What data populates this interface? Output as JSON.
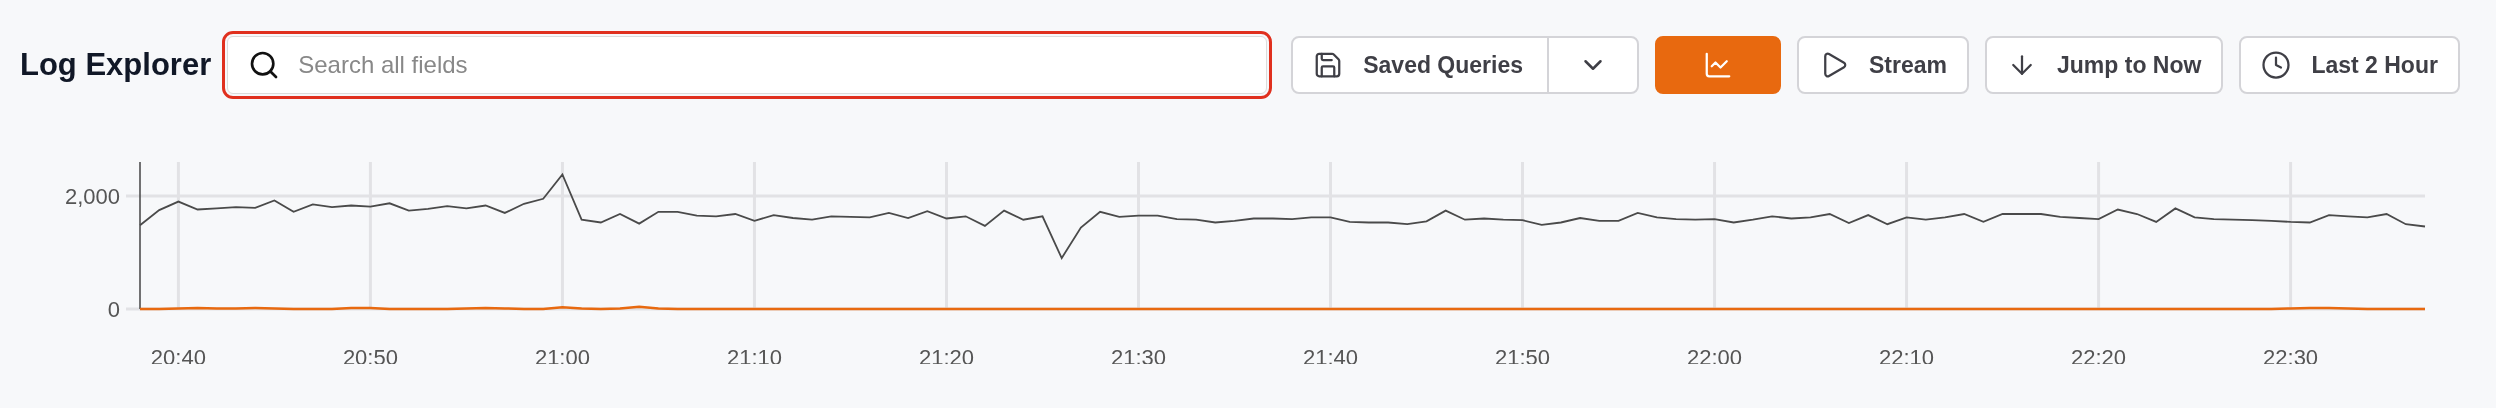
{
  "title": "Log Explorer",
  "search": {
    "placeholder": "Search all fields",
    "focused": true
  },
  "toolbar": [
    {
      "kind": "split",
      "label": "Saved Queries"
    },
    {
      "kind": "icon",
      "selected": true
    },
    {
      "kind": "button",
      "label": "Stream"
    },
    {
      "kind": "button",
      "label": "Jump to Now"
    },
    {
      "kind": "button",
      "label": "Last 2 Hour"
    }
  ],
  "chart": {
    "chart_data": {
      "type": "line",
      "grid": true,
      "ylim": [
        0,
        2600
      ],
      "categories": [
        null,
        null,
        "20:40",
        null,
        null,
        null,
        null,
        null,
        null,
        null,
        null,
        null,
        "20:50",
        null,
        null,
        null,
        null,
        null,
        null,
        null,
        null,
        null,
        "21:00",
        null,
        null,
        null,
        null,
        null,
        null,
        null,
        null,
        null,
        "21:10",
        null,
        null,
        null,
        null,
        null,
        null,
        null,
        null,
        null,
        "21:20",
        null,
        null,
        null,
        null,
        null,
        null,
        null,
        null,
        null,
        "21:30",
        null,
        null,
        null,
        null,
        null,
        null,
        null,
        null,
        null,
        "21:40",
        null,
        null,
        null,
        null,
        null,
        null,
        null,
        null,
        null,
        "21:50",
        null,
        null,
        null,
        null,
        null,
        null,
        null,
        null,
        null,
        "22:00",
        null,
        null,
        null,
        null,
        null,
        null,
        null,
        null,
        null,
        "22:10",
        null,
        null,
        null,
        null,
        null,
        null,
        null,
        null,
        null,
        "22:20",
        null,
        null,
        null,
        null,
        null,
        null,
        null,
        null,
        null,
        "22:30",
        null,
        null,
        null,
        null,
        null,
        null,
        null
      ],
      "yticks": [
        0,
        {
          "value": 2000,
          "label": "2,000"
        }
      ],
      "series": [
        {
          "color": "#4a4a4a",
          "values": [
            1480,
            1750,
            1900,
            1760,
            1780,
            1800,
            1790,
            1920,
            1720,
            1850,
            1800,
            1830,
            1810,
            1870,
            1740,
            1770,
            1820,
            1780,
            1830,
            1700,
            1860,
            1950,
            2380,
            1580,
            1530,
            1680,
            1510,
            1720,
            1720,
            1650,
            1640,
            1680,
            1560,
            1660,
            1610,
            1580,
            1640,
            1630,
            1620,
            1700,
            1610,
            1730,
            1600,
            1640,
            1470,
            1740,
            1580,
            1640,
            900,
            1440,
            1720,
            1630,
            1650,
            1650,
            1590,
            1580,
            1530,
            1560,
            1600,
            1600,
            1590,
            1620,
            1620,
            1540,
            1530,
            1530,
            1500,
            1550,
            1740,
            1580,
            1600,
            1580,
            1570,
            1490,
            1530,
            1610,
            1560,
            1560,
            1700,
            1620,
            1590,
            1580,
            1590,
            1530,
            1580,
            1640,
            1600,
            1620,
            1680,
            1520,
            1660,
            1500,
            1620,
            1580,
            1620,
            1680,
            1540,
            1680,
            1680,
            1680,
            1630,
            1610,
            1590,
            1760,
            1680,
            1540,
            1780,
            1620,
            1590,
            1580,
            1570,
            1560,
            1540,
            1530,
            1660,
            1640,
            1620,
            1680,
            1500,
            1460
          ]
        },
        {
          "color": "#e8690f",
          "values": [
            0,
            0,
            10,
            20,
            10,
            10,
            20,
            10,
            0,
            0,
            0,
            20,
            20,
            0,
            0,
            0,
            0,
            10,
            20,
            10,
            0,
            0,
            30,
            10,
            0,
            10,
            40,
            10,
            0,
            0,
            0,
            0,
            0,
            0,
            0,
            0,
            0,
            0,
            0,
            0,
            0,
            0,
            0,
            0,
            0,
            0,
            0,
            0,
            0,
            0,
            0,
            0,
            0,
            0,
            0,
            0,
            0,
            0,
            0,
            0,
            0,
            0,
            0,
            0,
            0,
            0,
            0,
            0,
            0,
            0,
            0,
            0,
            0,
            0,
            0,
            0,
            0,
            0,
            0,
            0,
            0,
            0,
            0,
            0,
            0,
            0,
            0,
            0,
            0,
            0,
            0,
            0,
            0,
            0,
            0,
            0,
            0,
            0,
            0,
            0,
            0,
            0,
            0,
            0,
            0,
            0,
            0,
            0,
            0,
            0,
            0,
            0,
            10,
            20,
            20,
            10,
            0,
            0,
            0,
            0
          ]
        }
      ]
    }
  }
}
